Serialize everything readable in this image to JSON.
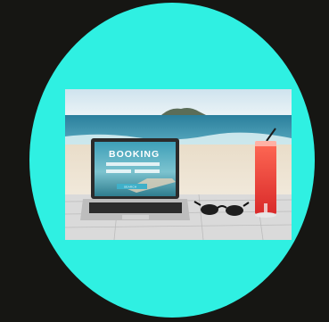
{
  "laptop_screen": {
    "title": "BOOKING",
    "button_label": "SEARCH"
  },
  "colors": {
    "page_background": "#161613",
    "circle": "#2ff0e2",
    "sea": "#2f88a3",
    "drink": "#ef3b3b"
  }
}
